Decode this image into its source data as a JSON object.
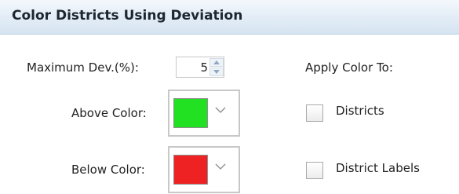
{
  "header": {
    "title": "Color Districts Using Deviation"
  },
  "deviation": {
    "label": "Maximum Dev.(%):",
    "value": "5"
  },
  "apply": {
    "label": "Apply Color To:",
    "options": [
      {
        "label": "Districts",
        "checked": false
      },
      {
        "label": "District Labels",
        "checked": false
      }
    ]
  },
  "above": {
    "label": "Above Color:",
    "color": "#22e022"
  },
  "below": {
    "label": "Below Color:",
    "color": "#ee2222"
  }
}
